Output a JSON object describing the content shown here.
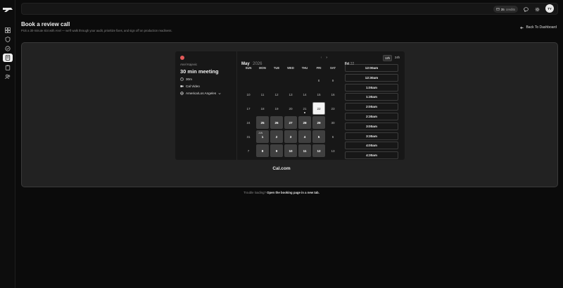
{
  "topbar": {
    "credits_value": "35",
    "credits_label": "credits",
    "avatar_initials": "TY"
  },
  "page": {
    "title": "Book a review call",
    "subtitle": "Pick a 30-minute slot with Anel — we'll walk through your audit, prioritize fixes, and sign off on production readiness.",
    "back_label": "Back To Dashboard"
  },
  "booking": {
    "host_name": "Anel Kajevic",
    "event_title": "30 min meeting",
    "duration": "30m",
    "location": "Cal Video",
    "timezone": "America/Los Angeles",
    "month": "May",
    "year": "2026",
    "weekdays": [
      "SUN",
      "MON",
      "TUE",
      "WED",
      "THU",
      "FRI",
      "SAT"
    ],
    "selected_day_name": "Fri",
    "selected_day_num": "22",
    "format_12h": "12h",
    "format_24h": "24h",
    "month_marker": "JUN",
    "slots": [
      "12:00am",
      "12:30am",
      "1:00am",
      "1:30am",
      "2:00am",
      "2:30am",
      "3:00am",
      "3:30am",
      "4:00am",
      "4:30am"
    ]
  },
  "brand": "Cal.com",
  "footer": {
    "prefix": "Trouble loading?",
    "link": "Open the booking page in a new tab."
  },
  "accent_colors": {
    "available_day": "#3f3f3f",
    "selected_day": "#f4f4f4",
    "host_avatar": "#e25a5a"
  }
}
